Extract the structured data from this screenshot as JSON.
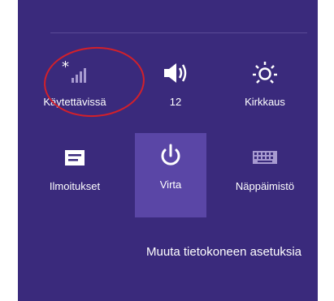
{
  "tiles": {
    "network": {
      "label": "Käytettävissä",
      "icon": "network-signal-icon"
    },
    "volume": {
      "label": "12",
      "icon": "speaker-icon"
    },
    "brightness": {
      "label": "Kirkkaus",
      "icon": "brightness-icon"
    },
    "notifications": {
      "label": "Ilmoitukset",
      "icon": "notifications-icon"
    },
    "power": {
      "label": "Virta",
      "icon": "power-icon"
    },
    "keyboard": {
      "label": "Näppäimistö",
      "icon": "keyboard-icon"
    }
  },
  "settings_link": "Muuta tietokoneen asetuksia",
  "colors": {
    "panel": "#3a2a7c",
    "active_tile": "#5a46a6",
    "highlight_ring": "#d3202a",
    "text": "#ffffff"
  }
}
